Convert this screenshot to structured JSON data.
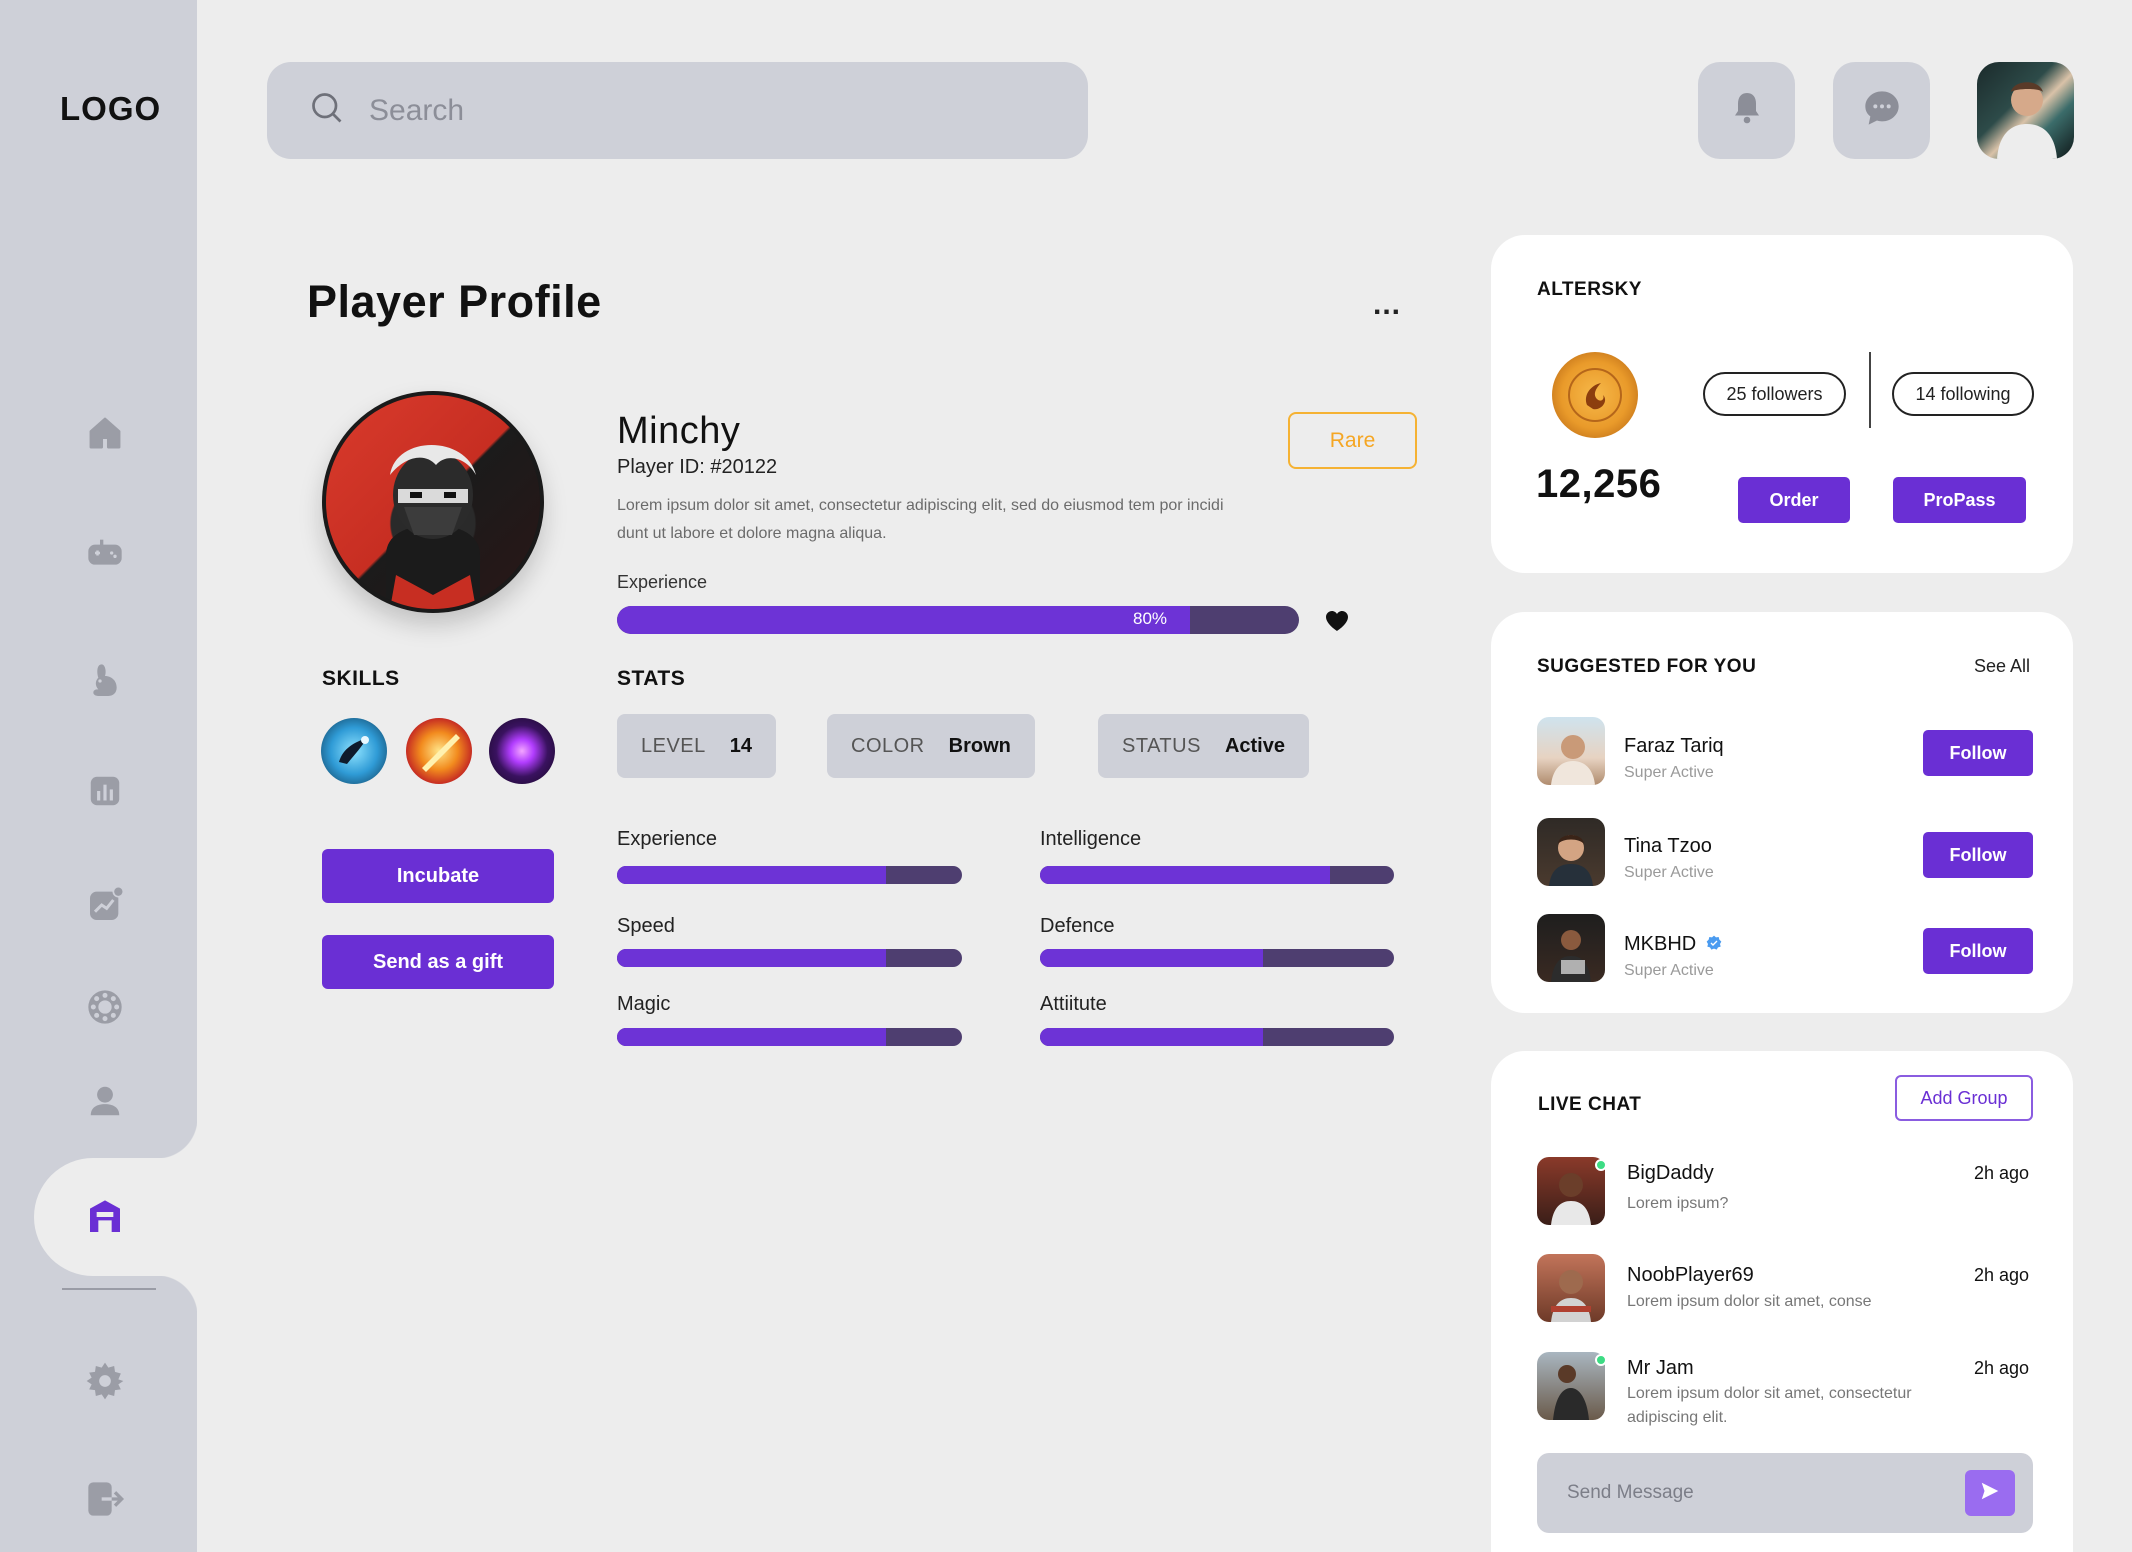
{
  "app": {
    "logo": "LOGO"
  },
  "search": {
    "placeholder": "Search"
  },
  "page": {
    "title": "Player Profile",
    "more": "..."
  },
  "player": {
    "name": "Minchy",
    "id": "Player ID: #20122",
    "description": "Lorem ipsum dolor sit amet, consectetur adipiscing elit, sed do eiusmod tem por incidi dunt ut labore et dolore magna aliqua.",
    "rarity": "Rare",
    "experience_label": "Experience",
    "experience_percent": "80%",
    "experience_fraction": 0.84
  },
  "skills": {
    "title": "SKILLS",
    "icons": [
      "blue-creature-skill-icon",
      "fire-slash-skill-icon",
      "purple-orb-skill-icon"
    ]
  },
  "stats": {
    "title": "STATS",
    "chips": [
      {
        "key": "LEVEL",
        "value": "14"
      },
      {
        "key": "COLOR",
        "value": "Brown"
      },
      {
        "key": "STATUS",
        "value": "Active"
      }
    ],
    "attributes": [
      {
        "label": "Experience",
        "fraction": 0.78
      },
      {
        "label": "Intelligence",
        "fraction": 0.82
      },
      {
        "label": "Speed",
        "fraction": 0.78
      },
      {
        "label": "Defence",
        "fraction": 0.63
      },
      {
        "label": "Magic",
        "fraction": 0.78
      },
      {
        "label": "Attiitute",
        "fraction": 0.63
      }
    ]
  },
  "actions": {
    "incubate": "Incubate",
    "gift": "Send as a gift"
  },
  "account": {
    "title": "ALTERSKY",
    "followers": "25 followers",
    "following": "14 following",
    "balance": "12,256",
    "order": "Order",
    "propass": "ProPass"
  },
  "suggested": {
    "title": "SUGGESTED FOR YOU",
    "see_all": "See All",
    "follow_label": "Follow",
    "users": [
      {
        "name": "Faraz Tariq",
        "status": "Super Active"
      },
      {
        "name": "Tina Tzoo",
        "status": "Super Active"
      },
      {
        "name": "MKBHD",
        "status": "Super Active",
        "verified": true
      }
    ]
  },
  "chat": {
    "title": "LIVE CHAT",
    "add_group": "Add Group",
    "messages": [
      {
        "name": "BigDaddy",
        "text": "Lorem ipsum?",
        "time": "2h ago",
        "online": true
      },
      {
        "name": "NoobPlayer69",
        "text": "Lorem ipsum dolor sit amet, conse",
        "time": "2h ago",
        "online": false
      },
      {
        "name": "Mr Jam",
        "text": "Lorem ipsum dolor sit amet, consectetur adipiscing elit.",
        "time": "2h ago",
        "online": true
      }
    ],
    "input_placeholder": "Send Message"
  },
  "colors": {
    "accent": "#6A2FD4",
    "bar_track": "#4E3E70",
    "rare": "#F5A623",
    "sidebar": "#CED0D8",
    "background": "#EDEDED"
  }
}
